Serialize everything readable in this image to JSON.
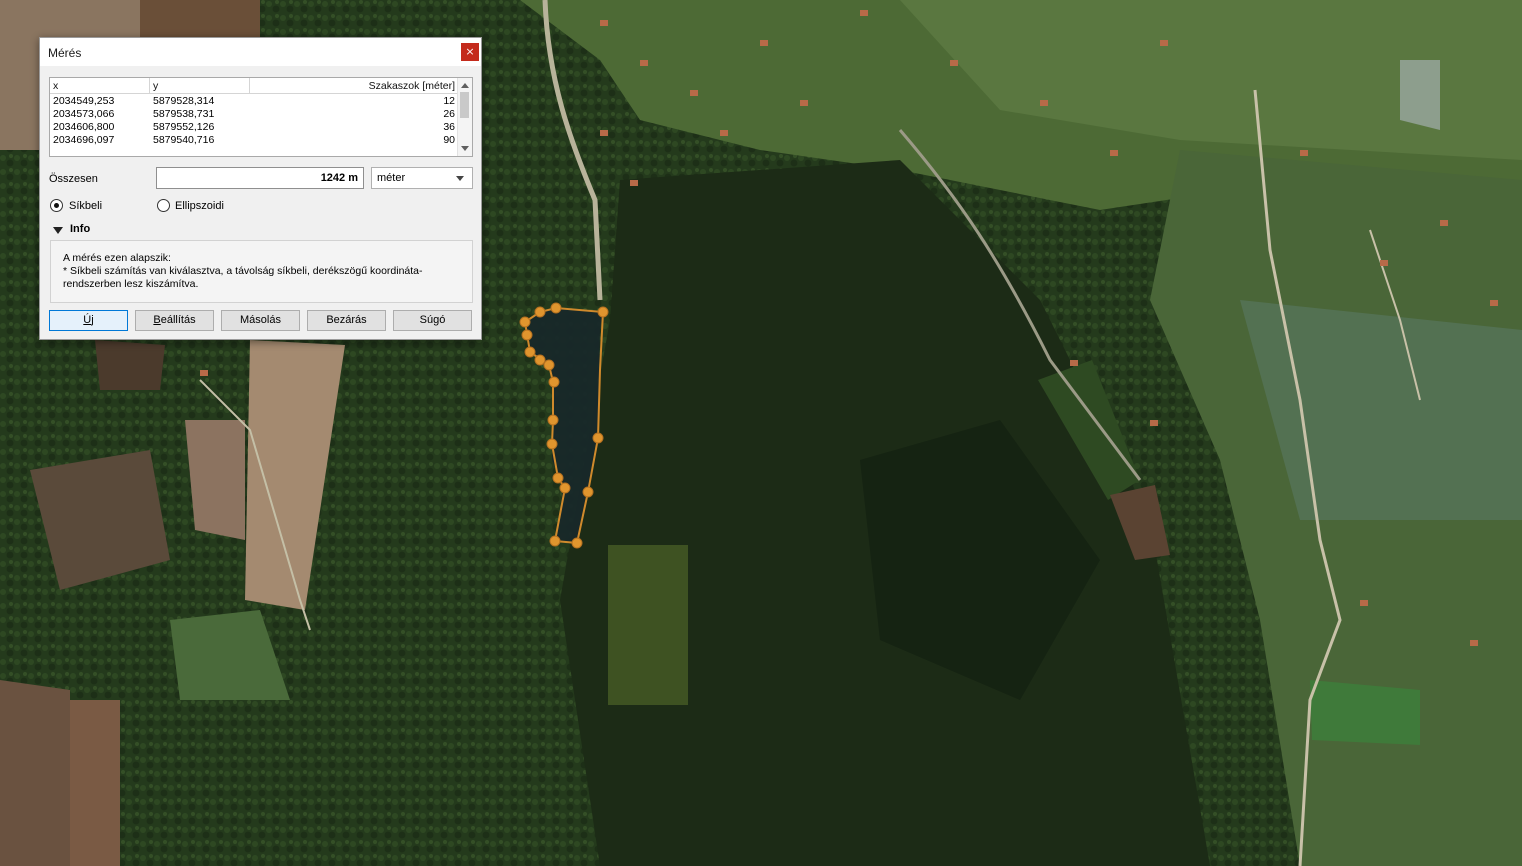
{
  "dialog": {
    "title": "Mérés",
    "close_glyph": "×",
    "table": {
      "headers": {
        "x": "x",
        "y": "y",
        "segments": "Szakaszok [méter]"
      },
      "rows": [
        {
          "x": "2034549,253",
          "y": "5879528,314",
          "segment": "12"
        },
        {
          "x": "2034573,066",
          "y": "5879538,731",
          "segment": "26"
        },
        {
          "x": "2034606,800",
          "y": "5879552,126",
          "segment": "36"
        },
        {
          "x": "2034696,097",
          "y": "5879540,716",
          "segment": "90"
        }
      ]
    },
    "total": {
      "label": "Összesen",
      "value": "1242 m",
      "unit": "méter"
    },
    "mode": {
      "options": [
        {
          "label": "Síkbeli",
          "checked": true
        },
        {
          "label": "Ellipszoidi",
          "checked": false
        }
      ]
    },
    "info": {
      "toggle_label": "Info",
      "lines": [
        "A mérés ezen alapszik:",
        "* Síkbeli számítás van kiválasztva, a távolság síkbeli, derékszögű koordináta-",
        "rendszerben lesz kiszámítva."
      ]
    },
    "buttons": {
      "new": {
        "first": "Ú",
        "rest": "j"
      },
      "settings": {
        "first": "B",
        "rest": "eállítás"
      },
      "copy": {
        "first": "",
        "rest": "Másolás"
      },
      "close": {
        "first": "",
        "rest": "Bezárás"
      },
      "help": {
        "first": "",
        "rest": "Súgó"
      }
    }
  },
  "colors": {
    "measure_line": "#d08a2c",
    "vertex": "#e0952e",
    "close_button": "#c42b1c",
    "forest": "#22361a",
    "water": "#1a2a2e"
  }
}
